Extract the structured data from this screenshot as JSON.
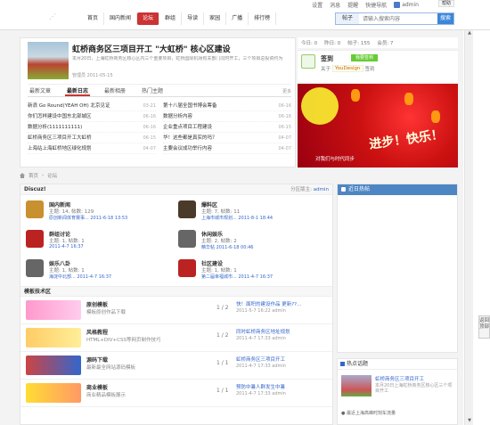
{
  "toplinks": {
    "items": [
      "设置",
      "消息",
      "提醒",
      "快捷导航"
    ],
    "user": "admin",
    "help": "帮助"
  },
  "nav": [
    "首页",
    "国内新闻",
    "论坛",
    "群组",
    "导读",
    "家园",
    "广播",
    "排行榜"
  ],
  "search": {
    "scope": "帖子",
    "placeholder": "请输入搜索内容",
    "button": "搜索"
  },
  "featured": {
    "title": "虹桥商务区三项目开工 \"大虹桥\" 核心区建设",
    "desc": "本月20日，上海虹桥商务区核心区内三个重要项目，虹桥国际机场有关部门同时开工，三个项目总投资约为",
    "meta": "管理员 2011-05-15"
  },
  "tabs": {
    "items": [
      "最新文章",
      "最新日志",
      "最新相册",
      "热门主题"
    ],
    "active": 1,
    "more": "更多"
  },
  "lists": {
    "left": [
      {
        "t": "新浪 Go Round(YEAH OH) 北京见证",
        "d": "03-21"
      },
      {
        "t": "你们怎样建设中国东北部城区",
        "d": "06-16"
      },
      {
        "t": "数据分析(1111111111)",
        "d": "06-16"
      },
      {
        "t": "虹桥商务区三项目开工大虹桥",
        "d": "06-15"
      },
      {
        "t": "上海站上海虹桥地区绿化规划",
        "d": "04-07"
      }
    ],
    "right": [
      {
        "t": "第十八届全国书博会筹备",
        "d": "06-16"
      },
      {
        "t": "数据分析内容",
        "d": "06-16"
      },
      {
        "t": "企业重点项目工程建设",
        "d": "06-15"
      },
      {
        "t": "华！这些都是真实的吗？",
        "d": "04-07"
      },
      {
        "t": "主要会议成功举行内容",
        "d": "04-07"
      }
    ]
  },
  "stats": [
    "今日: 0",
    "昨日: 0",
    "帖子: 155",
    "会员: 7"
  ],
  "signin": {
    "title": "签到",
    "button": "我要签到",
    "prefix": "关于",
    "link": "YouDesign",
    "suffix": "签到"
  },
  "banner": {
    "title": "进步！快乐！",
    "subtitle": "对我们与时代同步"
  },
  "breadcrumb": {
    "home": "首页",
    "sep": "›",
    "current": "论坛"
  },
  "section1": {
    "title": "Discuz!",
    "moderator_label": "分区版主:",
    "moderator": "admin"
  },
  "forums": [
    {
      "name": "国内新闻",
      "stats": "主题: 14, 帖数: 129",
      "last": "原创新闻体育赛事... 2011-6-18 13:53"
    },
    {
      "name": "爆料区",
      "stats": "主题: 7, 帖数: 11",
      "last": "上海市城市规划... 2011-8-1 18:44"
    },
    {
      "name": "群组讨论",
      "stats": "主题: 1, 帖数: 1",
      "last": "2011-4-7 16:37"
    },
    {
      "name": "休闲娱乐",
      "stats": "主题: 2, 帖数: 2",
      "last": "精华帖 2011-6-18 00:46"
    },
    {
      "name": "娱乐八卦",
      "stats": "主题: 1, 帖数: 1",
      "last": "海淀中北部... 2011-4-7 16:37"
    },
    {
      "name": "社区建设",
      "stats": "主题: 1, 帖数: 1",
      "last": "第二届幸福城市... 2011-4-7 16:37"
    }
  ],
  "section2": {
    "title": "模板技术区"
  },
  "frows": [
    {
      "name": "原创模板",
      "desc": "模板原创作品下载",
      "count": "1 / 2",
      "last": "快！面积的建设作品 更新??...",
      "meta": "2011-5-7 16:22 admin"
    },
    {
      "name": "风格教程",
      "desc": "HTML+DIV+CSS等网页制作技巧",
      "count": "1 / 2",
      "last": "同时虹桥商务区地址规划",
      "meta": "2011-4-7 17:33 admin"
    },
    {
      "name": "源码下载",
      "desc": "最新最全网站源码模板",
      "count": "1 / 1",
      "last": "虹桥商务区三项目开工",
      "meta": "2011-4-7 17:33 admin"
    },
    {
      "name": "商业模板",
      "desc": "商业精品模板展示",
      "count": "1 / 1",
      "last": "预防中暑人群发生中暑",
      "meta": "2011-4-7 17:33 admin"
    }
  ],
  "side": {
    "title": "近日热帖"
  },
  "hot": {
    "title": "热点话题",
    "item_title": "虹桥商务区三项目开工",
    "item_desc": "本月20日上海虹桥商务区核心区三个项目开工",
    "li": "● 最近上海高峰时刻车流量"
  },
  "totop": "返回顶部"
}
